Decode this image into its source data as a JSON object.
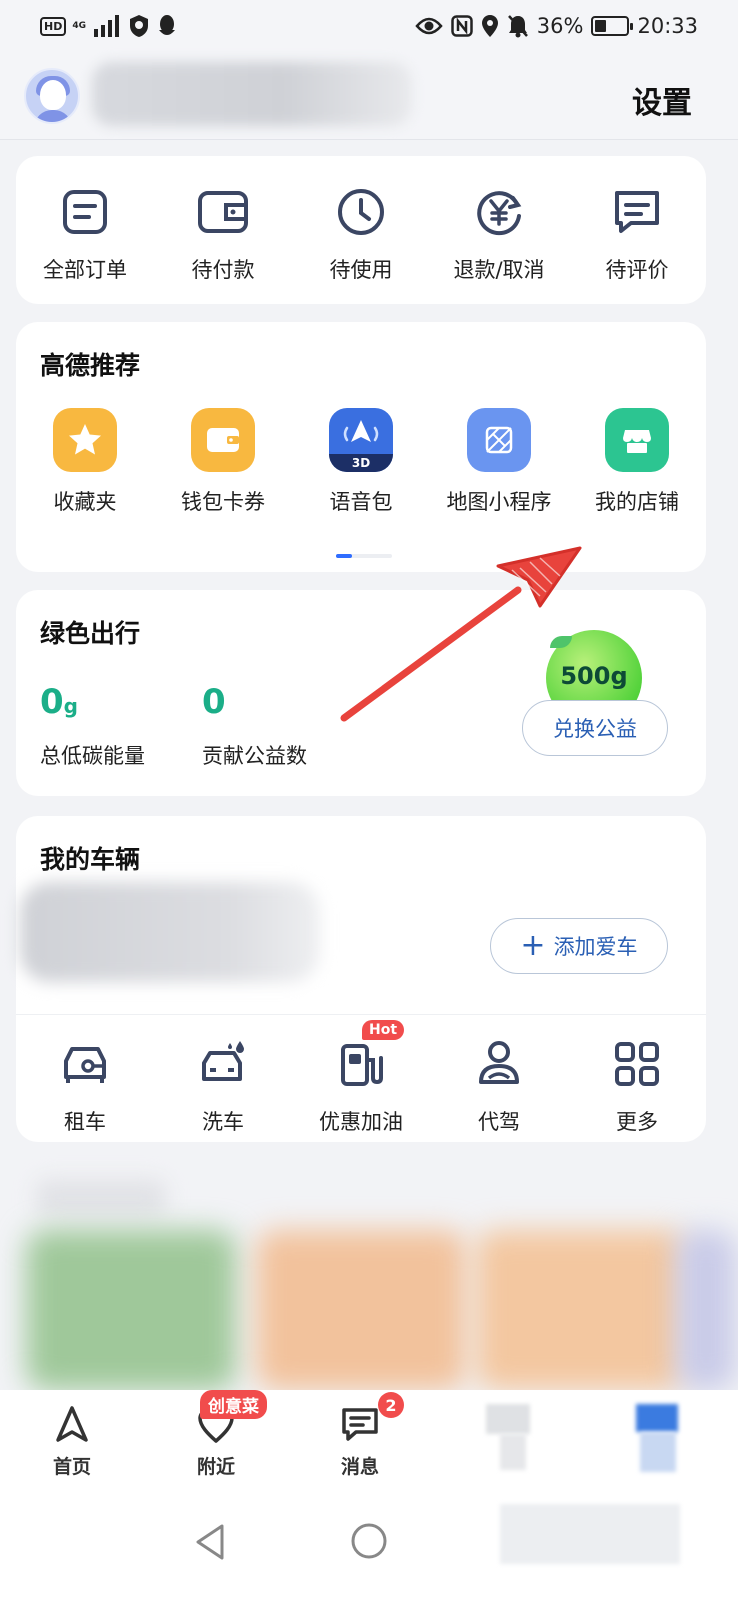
{
  "status_bar": {
    "hd": "HD",
    "network": "4G",
    "battery": "36%",
    "battery_level": 0.36,
    "time": "20:33"
  },
  "header": {
    "settings_label": "设置"
  },
  "orders": {
    "items": [
      {
        "label": "全部订单",
        "icon": "order-list-icon"
      },
      {
        "label": "待付款",
        "icon": "wallet-icon"
      },
      {
        "label": "待使用",
        "icon": "clock-icon"
      },
      {
        "label": "退款/取消",
        "icon": "refund-yen-icon"
      },
      {
        "label": "待评价",
        "icon": "comment-icon"
      }
    ]
  },
  "recommend": {
    "title": "高德推荐",
    "items": [
      {
        "label": "收藏夹",
        "icon": "star-icon",
        "color": "#f8b840"
      },
      {
        "label": "钱包卡券",
        "icon": "wallet-card-icon",
        "color": "#f8b840"
      },
      {
        "label": "语音包",
        "icon": "voice-pack-3d-icon",
        "color": "#3a6fe0",
        "badge": "3D"
      },
      {
        "label": "地图小程序",
        "icon": "mini-program-icon",
        "color": "#6a95f0"
      },
      {
        "label": "我的店铺",
        "icon": "shop-icon",
        "color": "#2cc591"
      }
    ]
  },
  "green": {
    "title": "绿色出行",
    "carbon_value": "0",
    "carbon_unit": "g",
    "carbon_label": "总低碳能量",
    "donation_value": "0",
    "donation_label": "贡献公益数",
    "ball_label": "500g",
    "exchange_label": "兑换公益"
  },
  "vehicle": {
    "title": "我的车辆",
    "add_car_label": "添加爱车",
    "services": [
      {
        "label": "租车",
        "icon": "car-rental-icon"
      },
      {
        "label": "洗车",
        "icon": "car-wash-icon"
      },
      {
        "label": "优惠加油",
        "icon": "fuel-pump-icon",
        "badge": "Hot"
      },
      {
        "label": "代驾",
        "icon": "driver-icon"
      },
      {
        "label": "更多",
        "icon": "grid-more-icon"
      }
    ]
  },
  "bottom_nav": {
    "items": [
      {
        "label": "首页",
        "icon": "navigation-arrow-icon"
      },
      {
        "label": "附近",
        "icon": "location-heart-icon",
        "badge": "创意菜"
      },
      {
        "label": "消息",
        "icon": "message-icon",
        "badge": "2"
      }
    ]
  },
  "colors": {
    "accent_green": "#1bae88",
    "accent_blue": "#2f6dff",
    "badge_red": "#f14c4c",
    "icon_navy": "#3b4663"
  }
}
